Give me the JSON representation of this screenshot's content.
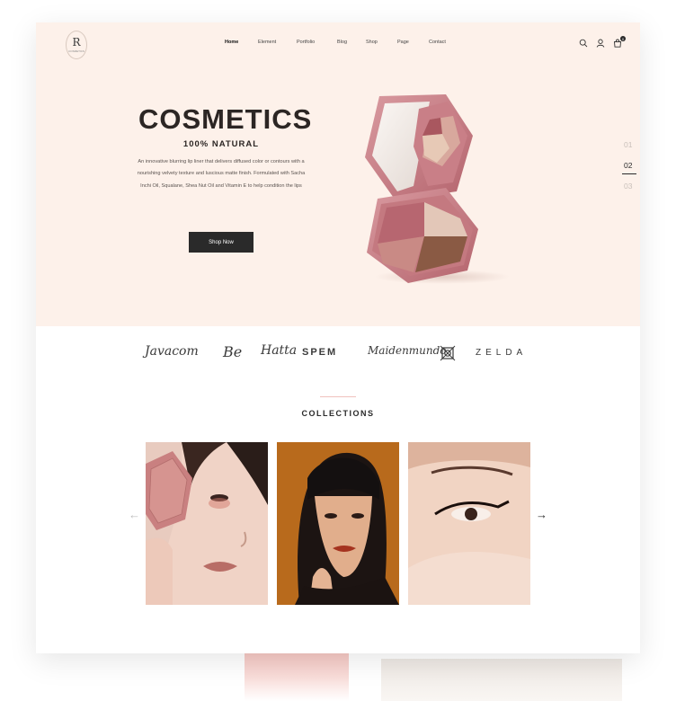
{
  "header": {
    "logo_letter": "R",
    "logo_sub": "COSMETICS",
    "nav": [
      "Home",
      "Element",
      "Portfolio",
      "Blog",
      "Shop",
      "Page",
      "Contact"
    ],
    "cart_count": "0"
  },
  "hero": {
    "title": "COSMETICS",
    "subtitle": "100%  NATURAL",
    "description": "An innovative blurring lip liner that delivers diffused color or contours with a nourishing velvety texture and luscious matte finish. Formulated with Sacha Inchi Oil, Squalane, Shea Nut Oil and Vitamin E to help condition the lips",
    "button": "Shop Now",
    "slides": [
      "01",
      "02",
      "03"
    ],
    "active_slide": "02"
  },
  "brands": [
    "Javacom",
    "Be",
    "Hatta",
    "SPEM",
    "Maidenmundo",
    "ZELDA"
  ],
  "collections": {
    "title": "COLLECTIONS",
    "prev_arrow": "←",
    "next_arrow": "→"
  },
  "colors": {
    "hero_bg": "#fdf1ea",
    "accent": "#c77b82",
    "dark": "#2a2a2a"
  }
}
